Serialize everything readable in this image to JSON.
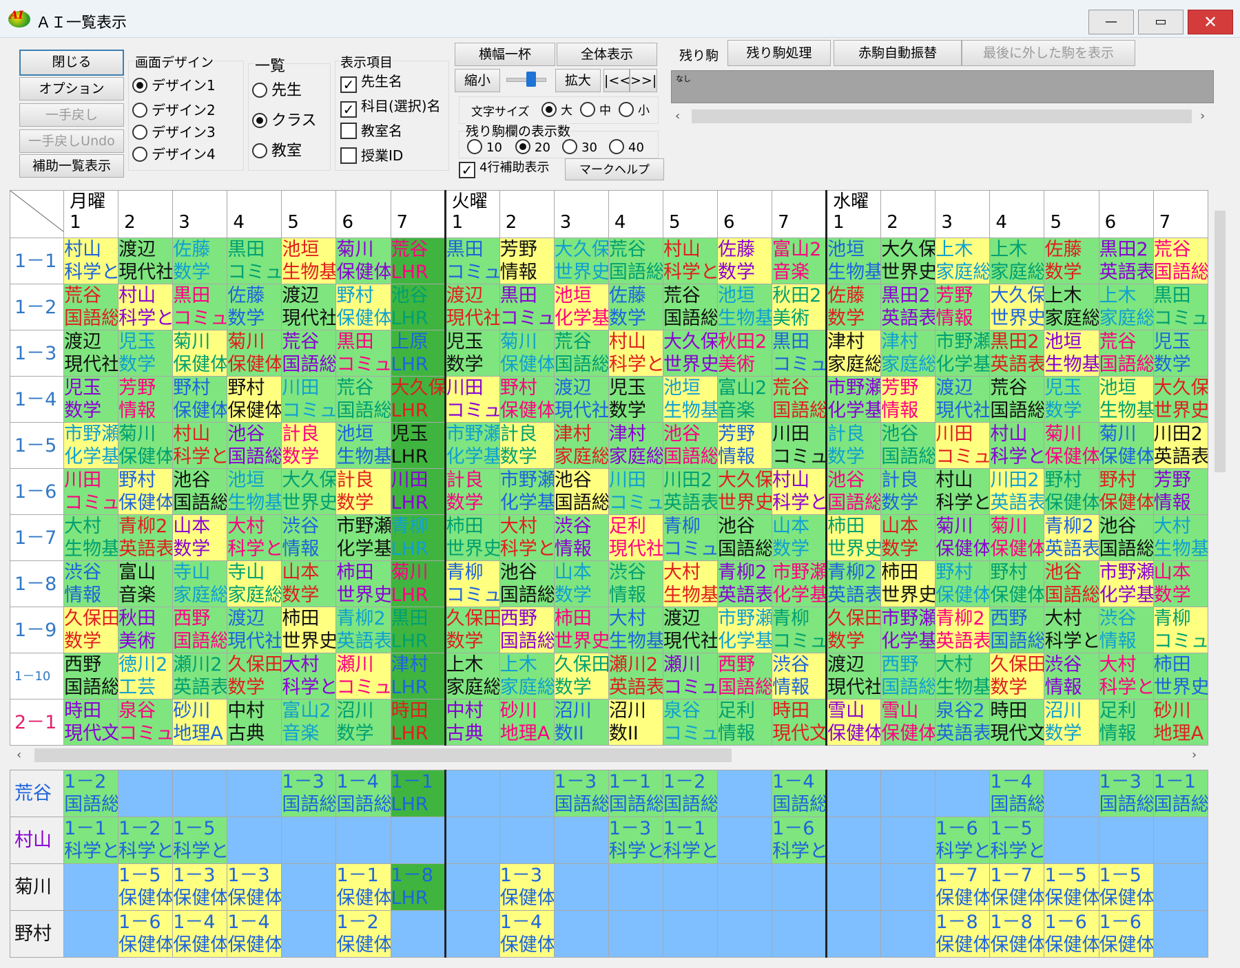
{
  "window": {
    "title": "ＡＩ一覧表示",
    "min": "—",
    "max": "▭",
    "close": "✕"
  },
  "left_buttons": [
    "閉じる",
    "オプション",
    "一手戻し",
    "一手戻しUndo",
    "補助一覧表示"
  ],
  "design": {
    "label": "画面デザイン",
    "options": [
      "デザイン1",
      "デザイン2",
      "デザイン3",
      "デザイン4"
    ],
    "selected": 0
  },
  "list": {
    "label": "一覧",
    "options": [
      "先生",
      "クラス",
      "教室"
    ],
    "selected": 1
  },
  "display": {
    "label": "表示項目",
    "items": [
      {
        "label": "先生名",
        "checked": true
      },
      {
        "label": "科目(選択)名",
        "checked": true
      },
      {
        "label": "教室名",
        "checked": false
      },
      {
        "label": "授業ID",
        "checked": false
      }
    ]
  },
  "view": {
    "fit_width": "横幅一杯",
    "show_all": "全体表示",
    "shrink": "縮小",
    "enlarge": "拡大",
    "first": "|<<",
    "last": ">>|"
  },
  "font_size": {
    "label": "文字サイズ",
    "options": [
      "大",
      "中",
      "小"
    ],
    "selected": 0
  },
  "remain_count": {
    "label": "残り駒欄の表示数",
    "options": [
      "10",
      "20",
      "30",
      "40"
    ],
    "selected": 1
  },
  "aux4": {
    "label": "4行補助表示",
    "checked": true
  },
  "mark_help": "マークヘルプ",
  "remain": {
    "label": "残り駒",
    "process": "残り駒処理",
    "red_auto": "赤駒自動振替",
    "show_last": "最後に外した駒を表示",
    "content": "なし"
  },
  "days": [
    "月曜",
    "火曜",
    "水曜"
  ],
  "periods": [
    "1",
    "2",
    "3",
    "4",
    "5",
    "6",
    "7"
  ],
  "classes": [
    "1－1",
    "1－2",
    "1－3",
    "1－4",
    "1－5",
    "1－6",
    "1－7",
    "1－8",
    "1－9",
    "1－10",
    "2－1"
  ],
  "grid": [
    [
      "村山/科学と",
      "渡辺/現代社",
      "佐藤/数学",
      "黒田/コミュ",
      "池垣/生物基",
      "菊川/保健体",
      "荒谷/LHR",
      "黒田/コミュ",
      "芳野/情報",
      "大久保/世界史",
      "荒谷/国語総",
      "村山/科学と",
      "佐藤/数学",
      "富山2/音楽",
      "池垣/生物基",
      "大久保/世界史",
      "上木/家庭総",
      "上木/家庭総",
      "佐藤/数学",
      "黒田2/英語表",
      "荒谷/国語総"
    ],
    [
      "荒谷/国語総",
      "村山/科学と",
      "黒田/コミュ",
      "佐藤/数学",
      "渡辺/現代社",
      "野村/保健体",
      "池谷/LHR",
      "渡辺/現代社",
      "黒田/コミュ",
      "池垣/化学基",
      "佐藤/数学",
      "荒谷/国語総",
      "池垣/生物基",
      "秋田2/美術",
      "佐藤/数学",
      "黒田2/英語表",
      "芳野/情報",
      "大久保/世界史",
      "上木/家庭総",
      "上木/家庭総",
      "黒田/コミュ"
    ],
    [
      "渡辺/現代社",
      "児玉/数学",
      "菊川/保健体",
      "菊川/保健体",
      "荒谷/国語総",
      "黒田/コミュ",
      "上原/LHR",
      "児玉/数学",
      "菊川/保健体",
      "荒谷/国語総",
      "村山/科学と",
      "大久保/世界史",
      "秋田2/美術",
      "黒田/コミュ",
      "津村/家庭総",
      "津村/家庭総",
      "市野瀬/化学基",
      "黒田2/英語表",
      "池垣/生物基",
      "荒谷/国語総",
      "児玉/数学"
    ],
    [
      "児玉/数学",
      "芳野/情報",
      "野村/保健体",
      "野村/保健体",
      "川田/コミュ",
      "荒谷/国語総",
      "大久保/LHR",
      "川田/コミュ",
      "野村/保健体",
      "渡辺/現代社",
      "児玉/数学",
      "池垣/生物基",
      "富山2/音楽",
      "荒谷/国語総",
      "市野瀬/化学基",
      "芳野/情報",
      "渡辺/現代社",
      "荒谷/国語総",
      "児玉/数学",
      "池垣/生物基",
      "大久保/世界史"
    ],
    [
      "市野瀬/化学基",
      "菊川/保健体",
      "村山/科学と",
      "池谷/国語総",
      "計良/数学",
      "池垣/生物基",
      "児玉/LHR",
      "市野瀬/化学基",
      "計良/数学",
      "津村/家庭総",
      "津村/家庭総",
      "池谷/国語総",
      "芳野/情報",
      "川田/コミュ",
      "計良/数学",
      "池谷/国語総",
      "川田/コミュ",
      "村山/科学と",
      "菊川/保健体",
      "菊川/保健体",
      "川田2/英語表"
    ],
    [
      "川田/コミュ",
      "野村/保健体",
      "池谷/国語総",
      "池垣/生物基",
      "大久保/世界史",
      "計良/数学",
      "川田/LHR",
      "計良/数学",
      "市野瀬/化学基",
      "池谷/国語総",
      "川田/コミュ",
      "川田2/英語表",
      "大久保/世界史",
      "村山/科学と",
      "池谷/国語総",
      "計良/数学",
      "村山/科学と",
      "川田2/英語表",
      "野村/保健体",
      "野村/保健体",
      "芳野/情報"
    ],
    [
      "大村/生物基",
      "青柳2/英語表",
      "山本/数学",
      "大村/科学と",
      "渋谷/情報",
      "市野瀬/化学基",
      "青柳/LHR",
      "柿田/世界史",
      "大村/科学と",
      "渋谷/情報",
      "足利/現代社",
      "青柳/コミュ",
      "池谷/国語総",
      "山本/数学",
      "柿田/世界史",
      "山本/数学",
      "菊川/保健体",
      "菊川/保健体",
      "青柳2/英語表",
      "池谷/国語総",
      "大村/生物基"
    ],
    [
      "渋谷/情報",
      "富山/音楽",
      "寺山/家庭総",
      "寺山/家庭総",
      "山本/数学",
      "柿田/世界史",
      "菊川/LHR",
      "青柳/コミュ",
      "池谷/国語総",
      "山本/数学",
      "渋谷/情報",
      "大村/生物基",
      "青柳2/英語表",
      "市野瀬/化学基",
      "青柳2/英語表",
      "柿田/世界史",
      "野村/保健体",
      "野村/保健体",
      "池谷/国語総",
      "市野瀬/化学基",
      "山本/数学"
    ],
    [
      "久保田/数学",
      "秋田/美術",
      "西野/国語総",
      "渡辺/現代社",
      "柿田/世界史",
      "青柳2/英語表",
      "黒田/LHR",
      "久保田/数学",
      "西野/国語総",
      "柿田/世界史",
      "大村/生物基",
      "渡辺/現代社",
      "市野瀬/化学基",
      "青柳/コミュ",
      "久保田/数学",
      "市野瀬/化学基",
      "青柳2/英語表",
      "西野/国語総",
      "大村/科学と",
      "渋谷/情報",
      "青柳/コミュ"
    ],
    [
      "西野/国語総",
      "徳川2/工芸",
      "瀬川2/英語表",
      "久保田/数学",
      "大村/科学と",
      "瀬川/コミュ",
      "津村/LHR",
      "上木/家庭総",
      "上木/家庭総",
      "久保田/数学",
      "瀬川2/英語表",
      "瀬川/コミュ",
      "西野/国語総",
      "渋谷/情報",
      "渡辺/現代社",
      "西野/国語総",
      "大村/生物基",
      "久保田/数学",
      "渋谷/情報",
      "大村/科学と",
      "柿田/世界史"
    ],
    [
      "時田/現代文",
      "泉谷/コミュ",
      "砂川/地理A",
      "中村/古典",
      "富山2/音楽",
      "沼川/数学",
      "時田/LHR",
      "中村/古典",
      "砂川/地理A",
      "沼川/数II",
      "沼川/数II",
      "泉谷/コミュ",
      "足利/情報",
      "時田/現代文",
      "雪山/保健体",
      "雪山/保健体",
      "泉谷2/英語表",
      "時田/現代文",
      "沼川/数学",
      "足利/情報",
      "砂川/地理A"
    ]
  ],
  "teachers": [
    "荒谷",
    "村山",
    "菊川",
    "野村"
  ],
  "teacher_grid": [
    [
      "1－2/国語総",
      "",
      "",
      "",
      "1－3/国語総",
      "1－4/国語総",
      "1－1/LHR",
      "",
      "",
      "1－3/国語総",
      "1－1/国語総",
      "1－2/国語総",
      "",
      "1－4/国語総",
      "",
      "",
      "",
      "1－4/国語総",
      "",
      "1－3/国語総",
      "1－1/国語総"
    ],
    [
      "1－1/科学と",
      "1－2/科学と",
      "1－5/科学と",
      "",
      "",
      "",
      "",
      "",
      "",
      "",
      "1－3/科学と",
      "1－1/科学と",
      "",
      "1－6/科学と",
      "",
      "",
      "1－6/科学と",
      "1－5/科学と",
      "",
      "",
      ""
    ],
    [
      "",
      "1－5/保健体",
      "1－3/保健体",
      "1－3/保健体",
      "",
      "1－1/保健体",
      "1－8/LHR",
      "",
      "1－3/保健体",
      "",
      "",
      "",
      "",
      "",
      "",
      "",
      "1－7/保健体",
      "1－7/保健体",
      "1－5/保健体",
      "1－5/保健体",
      ""
    ],
    [
      "",
      "1－6/保健体",
      "1－4/保健体",
      "1－4/保健体",
      "",
      "1－2/保健体",
      "",
      "",
      "1－4/保健体",
      "",
      "",
      "",
      "",
      "",
      "",
      "",
      "1－8/保健体",
      "1－8/保健体",
      "1－6/保健体",
      "1－6/保健体",
      ""
    ]
  ]
}
